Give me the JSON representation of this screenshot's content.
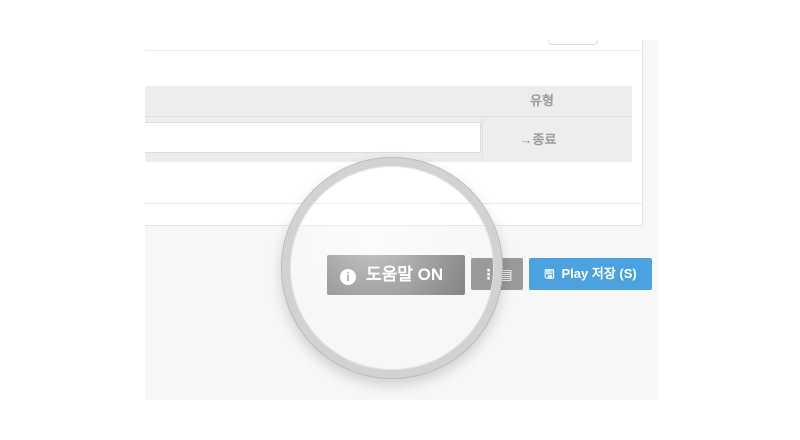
{
  "table": {
    "header_type": "유형",
    "row_type": "→종료"
  },
  "buttons": {
    "help": {
      "icon": "info-circle-icon",
      "label": "도움말 ON"
    },
    "more": {
      "label": "⋮ ▤"
    },
    "save": {
      "icon": "floppy-disk-icon",
      "label": "Play 저장 (S)"
    }
  },
  "colors": {
    "help_button": "#858588",
    "save_button": "#4aa3e0",
    "table_bg": "#ededee"
  }
}
